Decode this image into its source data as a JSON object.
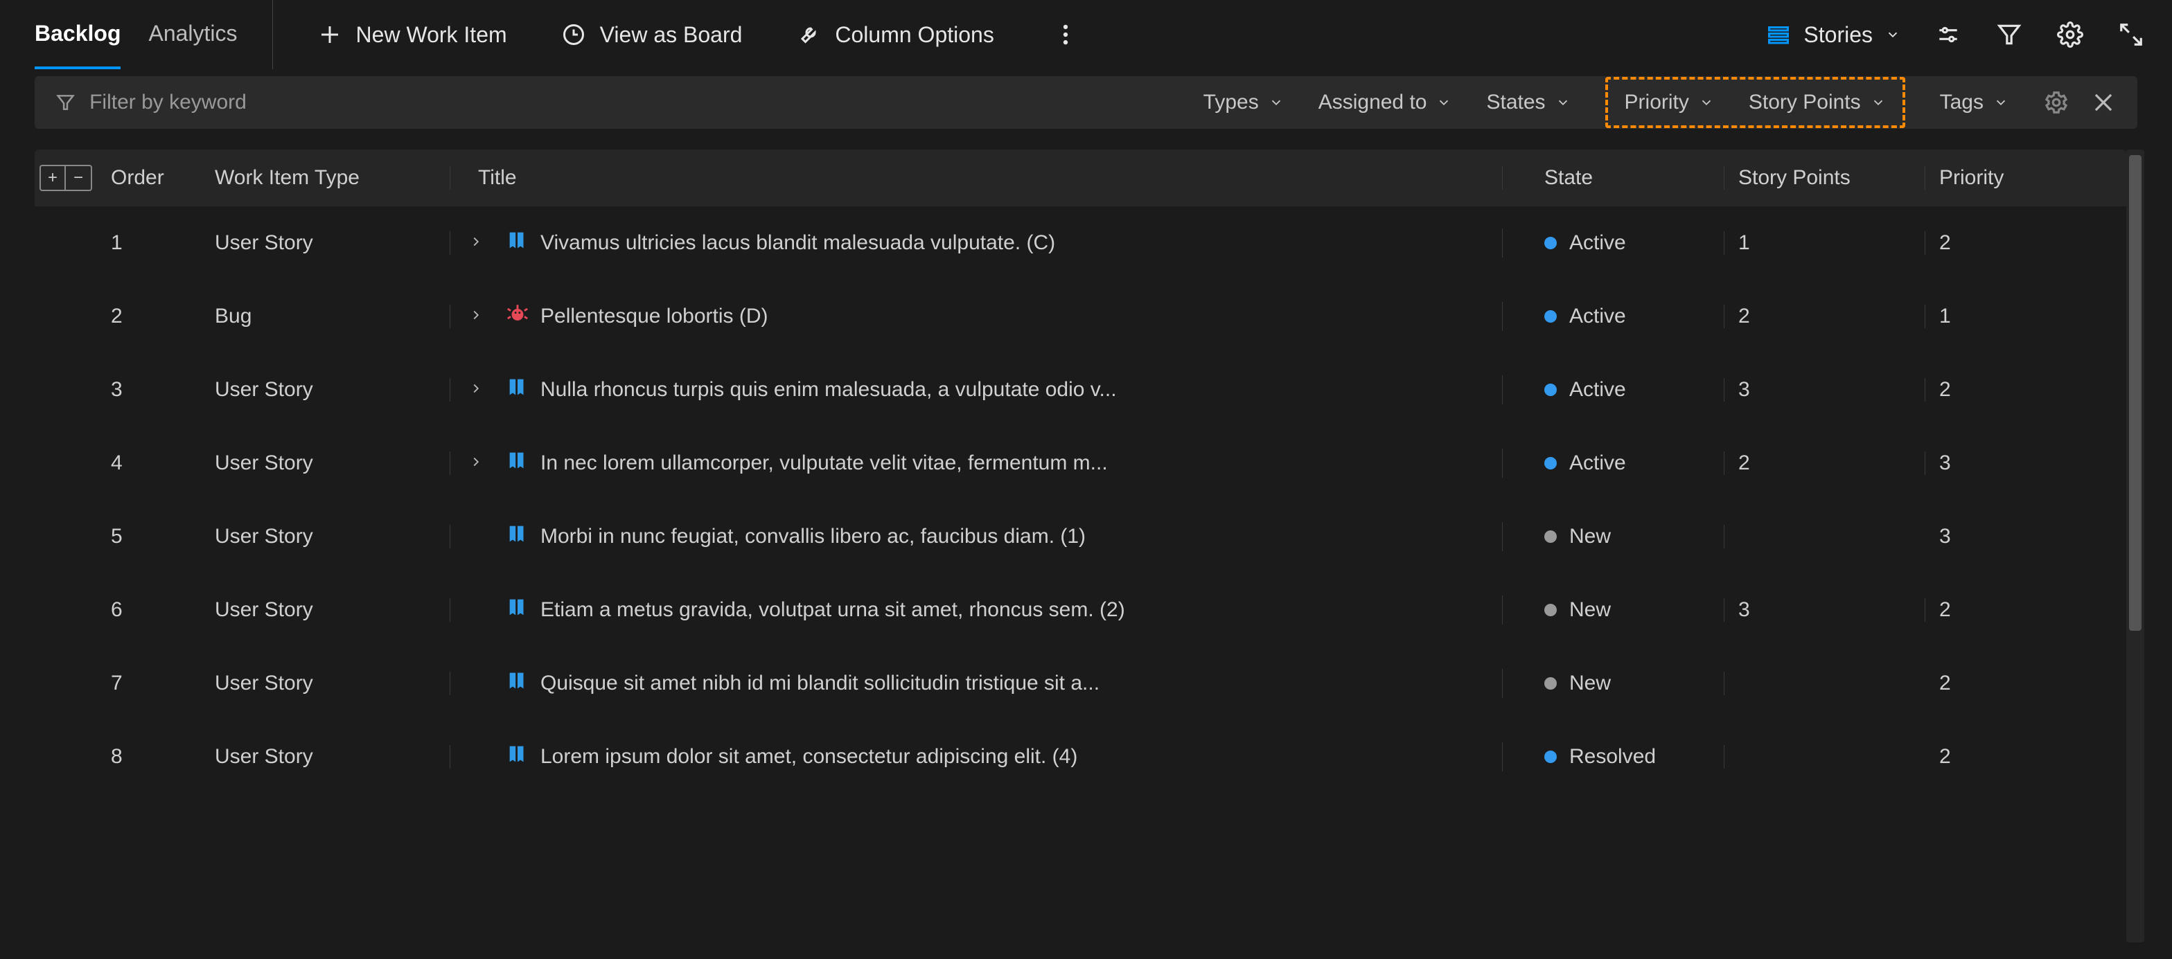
{
  "tabs": {
    "backlog": "Backlog",
    "analytics": "Analytics"
  },
  "commands": {
    "new_item": "New Work Item",
    "view_board": "View as Board",
    "column_options": "Column Options"
  },
  "level_selector": {
    "label": "Stories"
  },
  "filter": {
    "placeholder": "Filter by keyword",
    "chips": {
      "types": "Types",
      "assigned_to": "Assigned to",
      "states": "States",
      "priority": "Priority",
      "story_points": "Story Points",
      "tags": "Tags"
    }
  },
  "columns": {
    "order": "Order",
    "type": "Work Item Type",
    "title": "Title",
    "state": "State",
    "points": "Story Points",
    "priority": "Priority"
  },
  "state_colors": {
    "Active": "#339af0",
    "New": "#9a9a9a",
    "Resolved": "#339af0"
  },
  "rows": [
    {
      "order": "1",
      "type": "User Story",
      "kind": "story",
      "expand": true,
      "title": "Vivamus ultricies lacus blandit malesuada vulputate. (C)",
      "state": "Active",
      "points": "1",
      "priority": "2"
    },
    {
      "order": "2",
      "type": "Bug",
      "kind": "bug",
      "expand": true,
      "title": "Pellentesque lobortis (D)",
      "state": "Active",
      "points": "2",
      "priority": "1"
    },
    {
      "order": "3",
      "type": "User Story",
      "kind": "story",
      "expand": true,
      "title": "Nulla rhoncus turpis quis enim malesuada, a vulputate odio v...",
      "state": "Active",
      "points": "3",
      "priority": "2"
    },
    {
      "order": "4",
      "type": "User Story",
      "kind": "story",
      "expand": true,
      "title": "In nec lorem ullamcorper, vulputate velit vitae, fermentum m...",
      "state": "Active",
      "points": "2",
      "priority": "3"
    },
    {
      "order": "5",
      "type": "User Story",
      "kind": "story",
      "expand": false,
      "title": "Morbi in nunc feugiat, convallis libero ac, faucibus diam. (1)",
      "state": "New",
      "points": "",
      "priority": "3"
    },
    {
      "order": "6",
      "type": "User Story",
      "kind": "story",
      "expand": false,
      "title": "Etiam a metus gravida, volutpat urna sit amet, rhoncus sem. (2)",
      "state": "New",
      "points": "3",
      "priority": "2"
    },
    {
      "order": "7",
      "type": "User Story",
      "kind": "story",
      "expand": false,
      "title": "Quisque sit amet nibh id mi blandit sollicitudin tristique sit a...",
      "state": "New",
      "points": "",
      "priority": "2"
    },
    {
      "order": "8",
      "type": "User Story",
      "kind": "story",
      "expand": false,
      "title": "Lorem ipsum dolor sit amet, consectetur adipiscing elit. (4)",
      "state": "Resolved",
      "points": "",
      "priority": "2"
    }
  ]
}
